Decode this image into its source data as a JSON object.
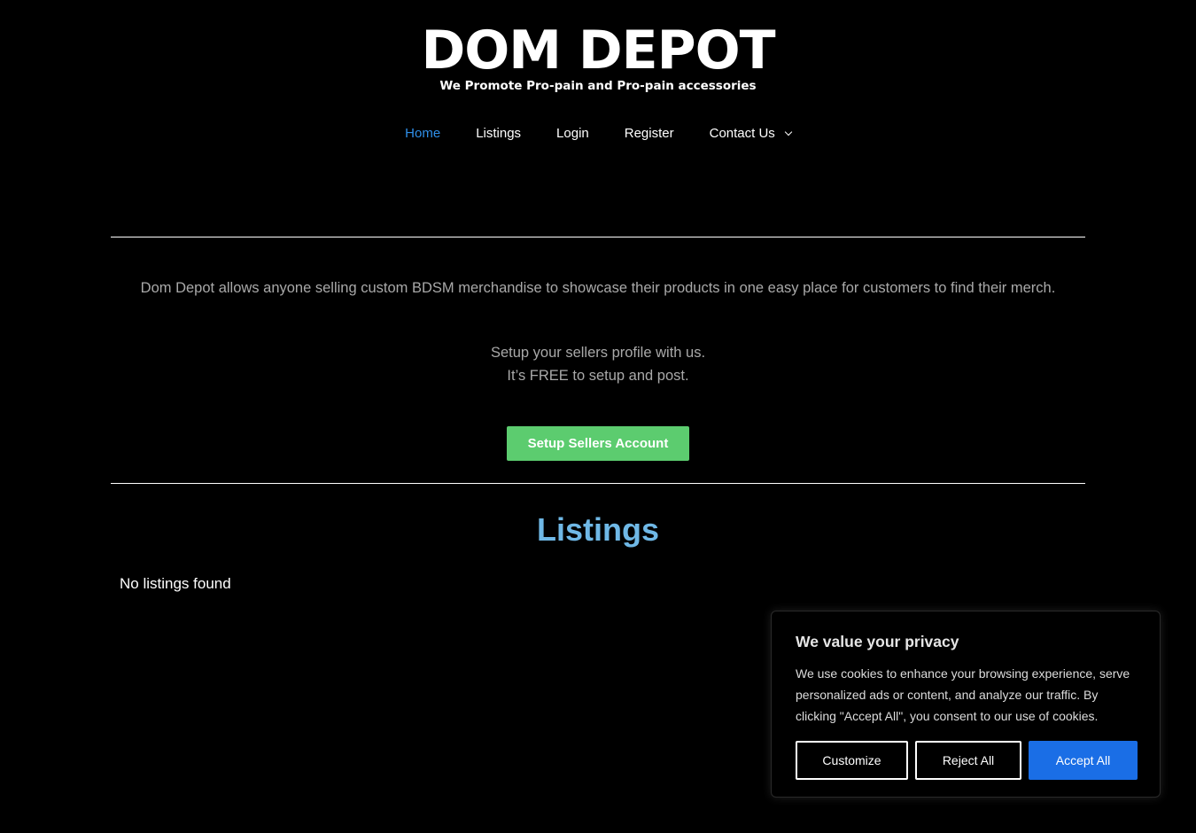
{
  "logo": {
    "title": "DOM DEPOT",
    "tagline": "We Promote Pro-pain and Pro-pain accessories"
  },
  "nav": {
    "items": [
      {
        "label": "Home",
        "active": true
      },
      {
        "label": "Listings"
      },
      {
        "label": "Login"
      },
      {
        "label": "Register"
      },
      {
        "label": "Contact Us",
        "has_dropdown": true
      }
    ]
  },
  "intro": {
    "text": "Dom Depot allows anyone selling custom BDSM merchandise to showcase their products in one easy place for customers to find their merch.",
    "line1": "Setup your sellers profile with us.",
    "line2": "It’s FREE to setup and post."
  },
  "cta": {
    "label": "Setup Sellers Account"
  },
  "listings": {
    "title": "Listings",
    "empty_text": "No listings found"
  },
  "cookie": {
    "title": "We value your privacy",
    "text": "We use cookies to enhance your browsing experience, serve personalized ads or content, and analyze our traffic. By clicking \"Accept All\", you consent to our use of cookies.",
    "customize": "Customize",
    "reject": "Reject All",
    "accept": "Accept All"
  },
  "colors": {
    "background": "#000000",
    "nav_active": "#2f8fe8",
    "cta": "#5ccc6f",
    "listings_title": "#6fb8e6",
    "accept_button": "#1a6ee6"
  }
}
